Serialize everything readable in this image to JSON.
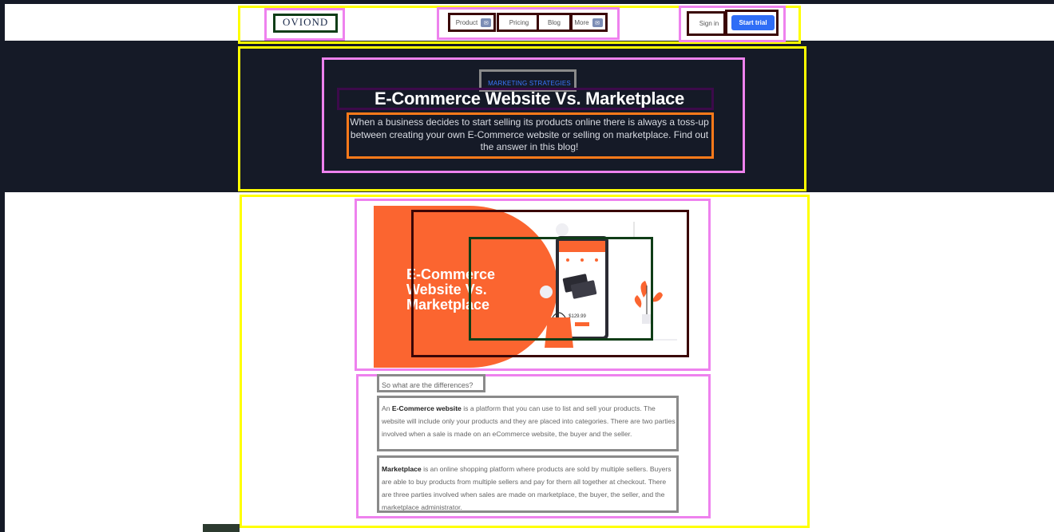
{
  "header": {
    "logo": "OVIOND",
    "nav": [
      {
        "label": "Product",
        "has_badge": true
      },
      {
        "label": "Pricing",
        "has_badge": false
      },
      {
        "label": "Blog",
        "has_badge": false
      },
      {
        "label": "More",
        "has_badge": true
      }
    ],
    "sign_in": "Sign in",
    "start_trial": "Start trial"
  },
  "hero": {
    "category": "MARKETING STRATEGIES",
    "title": "E-Commerce Website Vs. Marketplace",
    "description": "When a business decides to start selling its products online there is always a toss-up between creating your own E-Commerce website or selling on marketplace. Find out the answer in this blog!"
  },
  "cover": {
    "line1": "E-Commerce",
    "line2": "Website Vs.",
    "line3": "Marketplace",
    "price": "$129.99"
  },
  "article": {
    "question": "So what are the differences?",
    "p1_term": "E-Commerce website",
    "p1_prefix": "An ",
    "p1_rest": " is a platform that you can use to list and sell your products. The website will include only your products and they are placed into categories. There are two parties involved when a sale is made on an eCommerce website, the buyer and the seller.",
    "p2_term": "Marketplace",
    "p2_rest": " is an online shopping platform where products are sold by multiple sellers. Buyers are able to buy products from multiple sellers and pay for them all together at checkout. There are three parties involved when sales are made on marketplace, the buyer, the seller, and the marketplace administrator."
  },
  "colors": {
    "accent": "#2f6df6",
    "hero_bg": "#151a27",
    "cover_orange": "#fb6530"
  }
}
